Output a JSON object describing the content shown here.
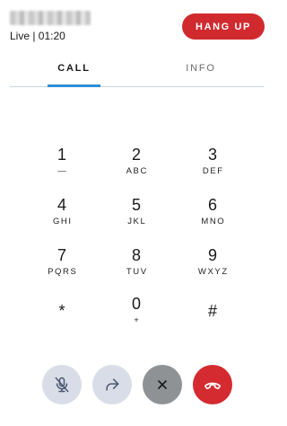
{
  "header": {
    "status": "Live | 01:20",
    "hangup_label": "HANG UP"
  },
  "tabs": [
    {
      "label": "CALL",
      "active": true
    },
    {
      "label": "INFO",
      "active": false
    }
  ],
  "dialpad": {
    "keys": [
      {
        "digit": "1",
        "letters": "—"
      },
      {
        "digit": "2",
        "letters": "ABC"
      },
      {
        "digit": "3",
        "letters": "DEF"
      },
      {
        "digit": "4",
        "letters": "GHI"
      },
      {
        "digit": "5",
        "letters": "JKL"
      },
      {
        "digit": "6",
        "letters": "MNO"
      },
      {
        "digit": "7",
        "letters": "PQRS"
      },
      {
        "digit": "8",
        "letters": "TUV"
      },
      {
        "digit": "9",
        "letters": "WXYZ"
      },
      {
        "digit": "*",
        "letters": ""
      },
      {
        "digit": "0",
        "letters": "+"
      },
      {
        "digit": "#",
        "letters": ""
      }
    ]
  },
  "actions": [
    {
      "name": "mute",
      "icon": "microphone-muted-icon"
    },
    {
      "name": "transfer",
      "icon": "forward-arrow-icon"
    },
    {
      "name": "dismiss",
      "icon": "close-icon"
    },
    {
      "name": "end-call",
      "icon": "phone-hangup-icon"
    }
  ],
  "colors": {
    "accent_red": "#d02a2f",
    "tab_indicator": "#2b8ed8",
    "action_light": "#d9dde8",
    "action_gray": "#8f9294"
  }
}
